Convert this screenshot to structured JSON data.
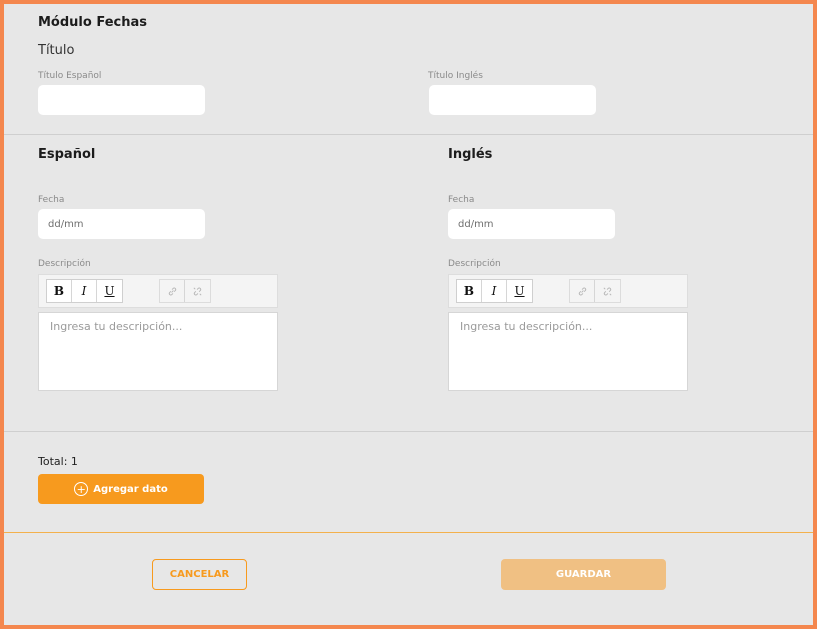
{
  "module": {
    "title": "Módulo Fechas"
  },
  "titulo_section": {
    "label": "Título",
    "spanish_label": "Título Español",
    "spanish_value": "",
    "english_label": "Título Inglés",
    "english_value": ""
  },
  "columns": [
    {
      "title": "Español",
      "date_label": "Fecha",
      "date_placeholder": "dd/mm",
      "description_label": "Descripción",
      "description_placeholder": "Ingresa tu descripción..."
    },
    {
      "title": "Inglés",
      "date_label": "Fecha",
      "date_placeholder": "dd/mm",
      "description_label": "Descripción",
      "description_placeholder": "Ingresa tu descripción..."
    }
  ],
  "toolbar": {
    "bold": "B",
    "italic": "I",
    "underline": "U",
    "link_icon": "link-icon",
    "unlink_icon": "unlink-icon"
  },
  "footer": {
    "total_text": "Total: 1",
    "add_label": "Agregar dato",
    "add_icon": "plus-circle-icon",
    "cancel_label": "CANCELAR",
    "save_label": "GUARDAR"
  },
  "colors": {
    "frame_border": "#f4874e",
    "accent": "#f79a1e",
    "save_disabled": "#f0c083",
    "background": "#e7e7e7"
  }
}
